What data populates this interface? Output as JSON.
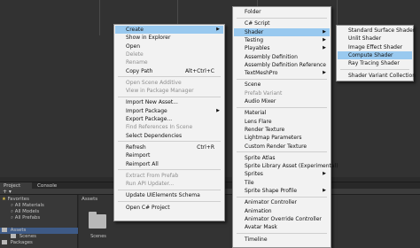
{
  "project_panel": {
    "tabs": [
      "Project",
      "Console"
    ],
    "tree": {
      "favorites": "Favorites",
      "fav_items": [
        "All Materials",
        "All Models",
        "All Prefabs"
      ],
      "assets": "Assets",
      "asset_items": [
        "Scenes"
      ],
      "packages": "Packages"
    },
    "main_header": "Assets",
    "folder_label": "Scenes"
  },
  "context_menu": {
    "items": [
      {
        "label": "Create",
        "shortcut": "",
        "submenu": true,
        "disabled": false,
        "highlighted": true
      },
      {
        "label": "Show in Explorer",
        "shortcut": "",
        "submenu": false,
        "disabled": false
      },
      {
        "label": "Open",
        "shortcut": "",
        "submenu": false,
        "disabled": false
      },
      {
        "label": "Delete",
        "shortcut": "",
        "submenu": false,
        "disabled": true
      },
      {
        "label": "Rename",
        "shortcut": "",
        "submenu": false,
        "disabled": true
      },
      {
        "label": "Copy Path",
        "shortcut": "Alt+Ctrl+C",
        "submenu": false,
        "disabled": false
      },
      {
        "label": "Open Scene Additive",
        "shortcut": "",
        "submenu": false,
        "disabled": true
      },
      {
        "label": "View in Package Manager",
        "shortcut": "",
        "submenu": false,
        "disabled": true
      },
      {
        "label": "Import New Asset...",
        "shortcut": "",
        "submenu": false,
        "disabled": false
      },
      {
        "label": "Import Package",
        "shortcut": "",
        "submenu": true,
        "disabled": false
      },
      {
        "label": "Export Package...",
        "shortcut": "",
        "submenu": false,
        "disabled": false
      },
      {
        "label": "Find References In Scene",
        "shortcut": "",
        "submenu": false,
        "disabled": true
      },
      {
        "label": "Select Dependencies",
        "shortcut": "",
        "submenu": false,
        "disabled": false
      },
      {
        "label": "Refresh",
        "shortcut": "Ctrl+R",
        "submenu": false,
        "disabled": false
      },
      {
        "label": "Reimport",
        "shortcut": "",
        "submenu": false,
        "disabled": false
      },
      {
        "label": "Reimport All",
        "shortcut": "",
        "submenu": false,
        "disabled": false
      },
      {
        "label": "Extract From Prefab",
        "shortcut": "",
        "submenu": false,
        "disabled": true
      },
      {
        "label": "Run API Updater...",
        "shortcut": "",
        "submenu": false,
        "disabled": true
      },
      {
        "label": "Update UIElements Schema",
        "shortcut": "",
        "submenu": false,
        "disabled": false
      },
      {
        "label": "Open C# Project",
        "shortcut": "",
        "submenu": false,
        "disabled": false
      }
    ]
  },
  "create_menu": {
    "items": [
      {
        "label": "Folder",
        "submenu": false,
        "disabled": false
      },
      {
        "label": "C# Script",
        "submenu": false,
        "disabled": false
      },
      {
        "label": "Shader",
        "submenu": true,
        "disabled": false,
        "highlighted": true
      },
      {
        "label": "Testing",
        "submenu": true,
        "disabled": false
      },
      {
        "label": "Playables",
        "submenu": true,
        "disabled": false
      },
      {
        "label": "Assembly Definition",
        "submenu": false,
        "disabled": false
      },
      {
        "label": "Assembly Definition Reference",
        "submenu": false,
        "disabled": false
      },
      {
        "label": "TextMeshPro",
        "submenu": true,
        "disabled": false
      },
      {
        "label": "Scene",
        "submenu": false,
        "disabled": false
      },
      {
        "label": "Prefab Variant",
        "submenu": false,
        "disabled": true
      },
      {
        "label": "Audio Mixer",
        "submenu": false,
        "disabled": false
      },
      {
        "label": "Material",
        "submenu": false,
        "disabled": false
      },
      {
        "label": "Lens Flare",
        "submenu": false,
        "disabled": false
      },
      {
        "label": "Render Texture",
        "submenu": false,
        "disabled": false
      },
      {
        "label": "Lightmap Parameters",
        "submenu": false,
        "disabled": false
      },
      {
        "label": "Custom Render Texture",
        "submenu": false,
        "disabled": false
      },
      {
        "label": "Sprite Atlas",
        "submenu": false,
        "disabled": false
      },
      {
        "label": "Sprite Library Asset (Experimental)",
        "submenu": false,
        "disabled": false
      },
      {
        "label": "Sprites",
        "submenu": true,
        "disabled": false
      },
      {
        "label": "Tile",
        "submenu": false,
        "disabled": false
      },
      {
        "label": "Sprite Shape Profile",
        "submenu": true,
        "disabled": false
      },
      {
        "label": "Animator Controller",
        "submenu": false,
        "disabled": false
      },
      {
        "label": "Animation",
        "submenu": false,
        "disabled": false
      },
      {
        "label": "Animator Override Controller",
        "submenu": false,
        "disabled": false
      },
      {
        "label": "Avatar Mask",
        "submenu": false,
        "disabled": false
      },
      {
        "label": "Timeline",
        "submenu": false,
        "disabled": false
      }
    ]
  },
  "shader_menu": {
    "items": [
      {
        "label": "Standard Surface Shader",
        "highlighted": false
      },
      {
        "label": "Unlit Shader",
        "highlighted": false
      },
      {
        "label": "Image Effect Shader",
        "highlighted": false
      },
      {
        "label": "Compute Shader",
        "highlighted": true
      },
      {
        "label": "Ray Tracing Shader",
        "highlighted": false
      },
      {
        "label": "Shader Variant Collection",
        "highlighted": false
      }
    ]
  }
}
